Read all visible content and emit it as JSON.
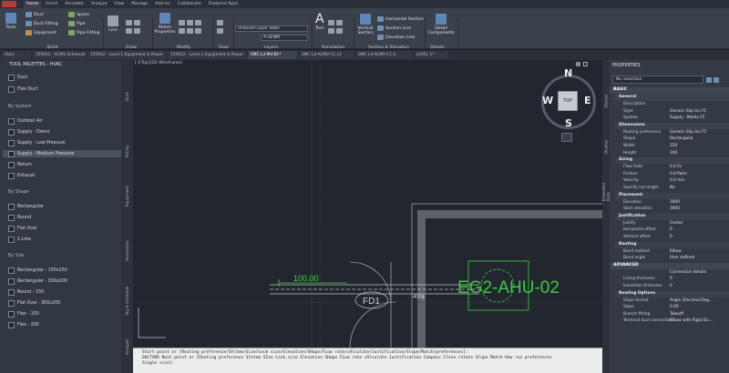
{
  "ribbon_tabs": [
    "Home",
    "Insert",
    "Annotate",
    "Analyze",
    "View",
    "Manage",
    "Add-ins",
    "Collaborate",
    "Featured Apps"
  ],
  "ribbon": {
    "tools": "Tools",
    "duct": "Duct",
    "duct_fitting": "Duct Fitting",
    "equipment": "Equipment",
    "space": "Space",
    "pipe": "Pipe",
    "pipe_fitting": "Pipe Fitting",
    "line": "Line",
    "match_properties": "Match Properties",
    "layer_state": "Unsaved Layer State",
    "layer_name": "A-GENM",
    "text": "Text",
    "vertical_section": "Vertical Section",
    "horizontal_section": "Horizontal Section",
    "section_line": "Section Line",
    "elevation_line": "Elevation Line",
    "detail_components": "Detail Components",
    "panels": [
      "Build",
      "Draw",
      "Modify",
      "View",
      "Layers",
      "Annotation",
      "Section & Elevation",
      "Details"
    ]
  },
  "file_tabs": [
    "Start",
    "150912 - ACMV Schematic - Level*",
    "150912 - Level 1 Equipment & Power",
    "150912 - Level 2 Equipment & Power",
    "SMC-L3-MV-B1*",
    "SMC-L4-ACMV-C1-L2",
    "SMC-L4-ACMV-C1-2",
    "LEVEL 1*"
  ],
  "palette": {
    "title": "TOOL PALETTES - HVAC",
    "top_items": [
      "Duct",
      "Flex Duct"
    ],
    "by_system_label": "By System",
    "by_system": [
      "Outdoor Air",
      "Supply - Demo",
      "Supply - Low Pressure",
      "Supply - Medium Pressure",
      "Return",
      "Exhaust"
    ],
    "by_shape_label": "By Shape",
    "by_shape": [
      "Rectangular",
      "Round",
      "Flat Oval",
      "1-Line"
    ],
    "by_size_label": "By Size",
    "by_size": [
      "Rectangular - 150x150",
      "Rectangular - 300x200",
      "Round - 150",
      "Flat Oval - 300x200",
      "Flex - 150",
      "Flex - 200"
    ],
    "vertical_tabs": [
      "Duct",
      "Fitting",
      "Equipment",
      "Annotation",
      "Tag & Schedule",
      "Analysis"
    ]
  },
  "viewport": {
    "label": "[-][Top][2D Wireframe]",
    "viewcube_face": "TOP",
    "compass": {
      "n": "N",
      "s": "S",
      "e": "E",
      "w": "W"
    },
    "dim_text": "100.00",
    "tag_fd": "FD1",
    "tag_size": "400ϕ",
    "equipment_tag": "EG2-AHU-02"
  },
  "command": {
    "line1": "Start point or [Routing preference/SYstem/Size/Lock size/Elevation/SHape/FLow rate/cAlculate/Justification/Slope/Match/preferences]:",
    "line2": "DUCTADD Next point or [Routing preference SYstem SIze Lock size Elevation SHape FLow rate cAlculate Justification Compass Close rotate Slope Match Hew run preferences Single size]:"
  },
  "properties": {
    "title": "PROPERTIES",
    "selection": "No selection",
    "tab_basic": "BASIC",
    "side_tabs": [
      "Design",
      "Display",
      "Extended Data"
    ],
    "general_label": "General",
    "general": [
      [
        "Description",
        ""
      ],
      [
        "Style",
        "Generic Slip Ins F5"
      ],
      [
        "System",
        "Supply - Medio F5"
      ]
    ],
    "dimensions_label": "Dimensions",
    "dimensions": [
      [
        "Routing preference",
        "Generic Slip Ins F5"
      ],
      [
        "Shape",
        "Rectangular"
      ],
      [
        "Width",
        "250"
      ],
      [
        "Height",
        "200"
      ]
    ],
    "sizing_label": "Sizing",
    "sizing": [
      [
        "Flow Rate",
        "0.0 l/s"
      ],
      [
        "Friction",
        "0.0 Pa/m"
      ],
      [
        "Velocity",
        "0.0 m/s"
      ],
      [
        "Specify cut length",
        "No"
      ]
    ],
    "placement_label": "Placement",
    "placement": [
      [
        "Elevation",
        "3000"
      ],
      [
        "Start elevation",
        "3000"
      ]
    ],
    "justification_label": "Justification",
    "justification": [
      [
        "Justify",
        "Center"
      ],
      [
        "Horizontal offset",
        "0"
      ],
      [
        "Vertical offset",
        "0"
      ]
    ],
    "routing_label": "Routing",
    "routing": [
      [
        "Bend method",
        "Elbow"
      ],
      [
        "Bend angle",
        "User defined"
      ]
    ],
    "advanced_label": "ADVANCED",
    "advanced": [
      [
        "",
        "Connection details"
      ],
      [
        "Lining thickness",
        "0"
      ],
      [
        "Insulation thickness",
        "0"
      ]
    ],
    "routing_options_label": "Routing Options",
    "routing_options": [
      [
        "Slope format",
        "Angle (Decimal Deg..."
      ],
      [
        "Slope",
        "0.00"
      ],
      [
        "Branch fitting",
        "Takeoff"
      ],
      [
        "Terminal duct connection",
        "Elbow with Rigid Du..."
      ]
    ]
  }
}
